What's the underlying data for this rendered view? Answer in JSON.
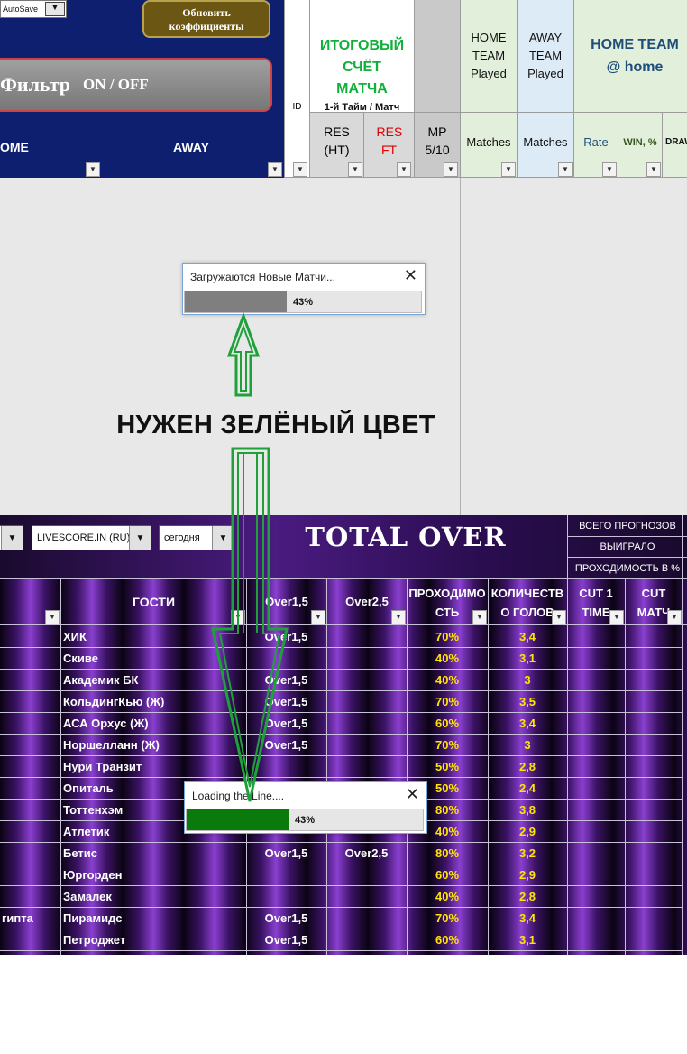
{
  "top_sheet": {
    "autosave_label": "AutoSave",
    "refresh_button": "Обновить коэффициенты",
    "filter_button_prefix": "Фильтр",
    "filter_button_suffix": "ON / OFF",
    "col_home": "OME",
    "col_away": "AWAY",
    "col_id": "ID",
    "final_score_title": "ИТОГОВЫЙ СЧЁТ МАТЧА",
    "final_score_sub": "1-й Тайм / Матч",
    "res_ht": "RES (HT)",
    "res_ft": "RES FT",
    "mp": "MP 5/10",
    "home_team_played": "HOME TEAM Played",
    "away_team_played": "AWAY TEAM Played",
    "home_team_at_home": "HOME TEAM @ home",
    "matches1": "Matches",
    "matches2": "Matches",
    "rate": "Rate",
    "win_pct": "WIN, %",
    "draw": "DRAW"
  },
  "dialog1": {
    "title": "Загружаются Новые Матчи...",
    "progress_percent": 43,
    "progress_label": "43%",
    "bar_color": "#7f7f7f"
  },
  "dialog2": {
    "title": "Loading the Line....",
    "progress_percent": 43,
    "progress_label": "43%",
    "bar_color": "#0a7a0a"
  },
  "annotation": {
    "text": "НУЖЕН ЗЕЛЁНЫЙ ЦВЕТ",
    "arrow_color": "#1fa13a"
  },
  "bottom_sheet": {
    "source_select": "LIVESCORE.IN (RU)",
    "day_select": "сегодня",
    "title": "TOTAL OVER",
    "stats": [
      "ВСЕГО ПРОГНОЗОВ",
      "ВЫИГРАЛО",
      "ПРОХОДИМОСТЬ В %"
    ],
    "headers": {
      "guests": "ГОСТИ",
      "over15": "Over1,5",
      "over25": "Over2,5",
      "passability": "ПРОХОДИМОСТЬ",
      "goals": "КОЛИЧЕСТВО ГОЛОВ",
      "cut1": "CUT 1 TIME",
      "cut2": "CUT МАТЧ"
    },
    "rows": [
      {
        "home": "",
        "guest": "ХИК",
        "o15": "Over1,5",
        "o25": "",
        "pct": "70%",
        "goals": "3,4"
      },
      {
        "home": "",
        "guest": "Скиве",
        "o15": "",
        "o25": "",
        "pct": "40%",
        "goals": "3,1"
      },
      {
        "home": "",
        "guest": "Академик БК",
        "o15": "Over1,5",
        "o25": "",
        "pct": "40%",
        "goals": "3"
      },
      {
        "home": "",
        "guest": "КольдингКью (Ж)",
        "o15": "Over1,5",
        "o25": "",
        "pct": "70%",
        "goals": "3,5"
      },
      {
        "home": "",
        "guest": "АСА Орхус (Ж)",
        "o15": "Over1,5",
        "o25": "",
        "pct": "60%",
        "goals": "3,4"
      },
      {
        "home": "",
        "guest": "Норшелланн (Ж)",
        "o15": "Over1,5",
        "o25": "",
        "pct": "70%",
        "goals": "3"
      },
      {
        "home": "",
        "guest": "Нури Транзит",
        "o15": "",
        "o25": "",
        "pct": "50%",
        "goals": "2,8"
      },
      {
        "home": "",
        "guest": "Опиталь",
        "o15": "",
        "o25": "",
        "pct": "50%",
        "goals": "2,4"
      },
      {
        "home": "",
        "guest": "Тоттенхэм",
        "o15": "",
        "o25": "",
        "pct": "80%",
        "goals": "3,8"
      },
      {
        "home": "",
        "guest": "Атлетик",
        "o15": "",
        "o25": "",
        "pct": "40%",
        "goals": "2,9"
      },
      {
        "home": "",
        "guest": "Бетис",
        "o15": "Over1,5",
        "o25": "Over2,5",
        "pct": "80%",
        "goals": "3,2"
      },
      {
        "home": "",
        "guest": "Юргорден",
        "o15": "",
        "o25": "",
        "pct": "60%",
        "goals": "2,9"
      },
      {
        "home": "",
        "guest": "Замалек",
        "o15": "",
        "o25": "",
        "pct": "40%",
        "goals": "2,8"
      },
      {
        "home": "гипта",
        "guest": "Пирамидс",
        "o15": "Over1,5",
        "o25": "",
        "pct": "70%",
        "goals": "3,4"
      },
      {
        "home": "",
        "guest": "Петроджет",
        "o15": "Over1,5",
        "o25": "",
        "pct": "60%",
        "goals": "3,1"
      }
    ]
  }
}
